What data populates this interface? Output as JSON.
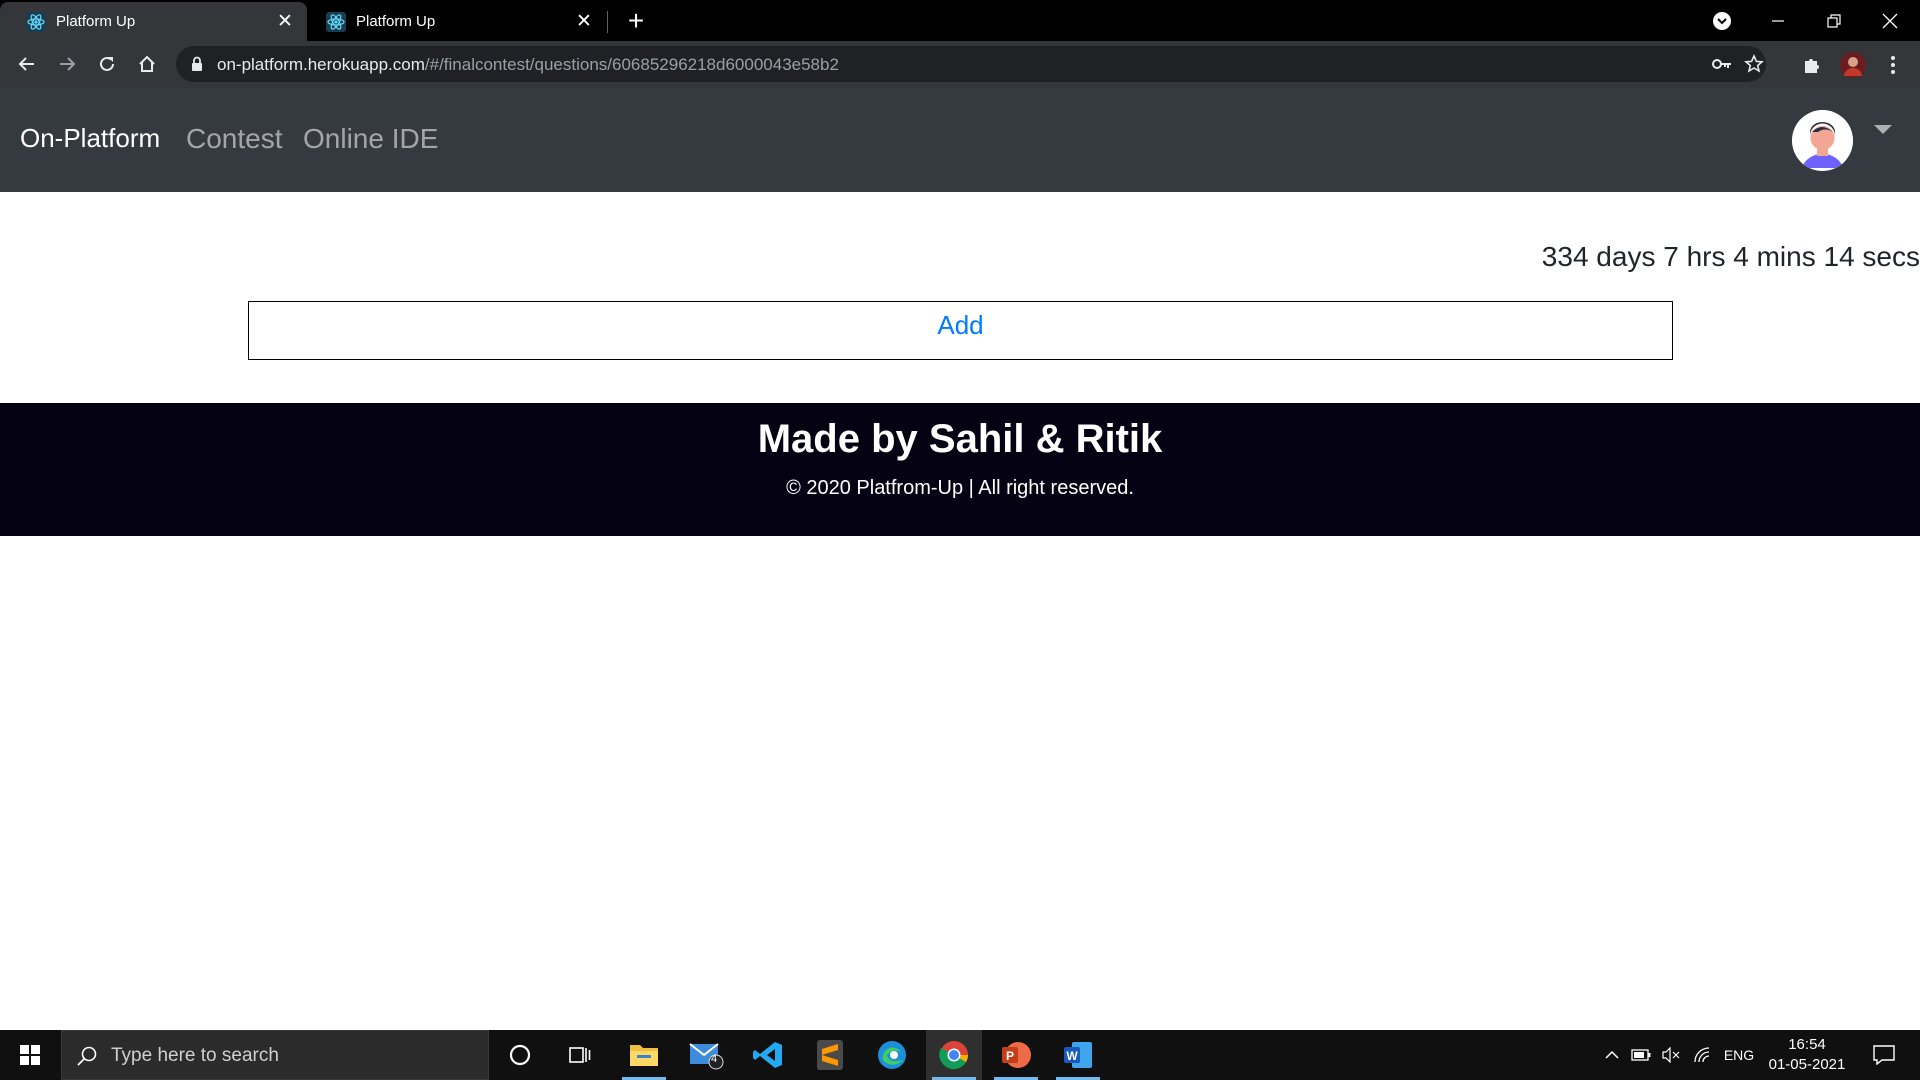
{
  "browser": {
    "tabs": [
      {
        "title": "Platform Up",
        "active": true
      },
      {
        "title": "Platform Up",
        "active": false
      }
    ],
    "url_host": "on-platform.herokuapp.com",
    "url_path": "/#/finalcontest/questions/60685296218d6000043e58b2"
  },
  "navbar": {
    "brand": "On-Platform",
    "links": [
      "Contest",
      "Online IDE"
    ]
  },
  "main": {
    "timer": "334 days 7 hrs 4 mins 14 secs",
    "add_label": "Add"
  },
  "footer": {
    "title": "Made by Sahil & Ritik",
    "copyright": "© 2020 Platfrom-Up | All right reserved."
  },
  "taskbar": {
    "search_placeholder": "Type here to search",
    "mail_badge": "4",
    "language": "ENG",
    "time": "16:54",
    "date": "01-05-2021"
  },
  "colors": {
    "navbar_bg": "#343a40",
    "footer_bg": "#050313",
    "link_blue": "#007bff"
  }
}
